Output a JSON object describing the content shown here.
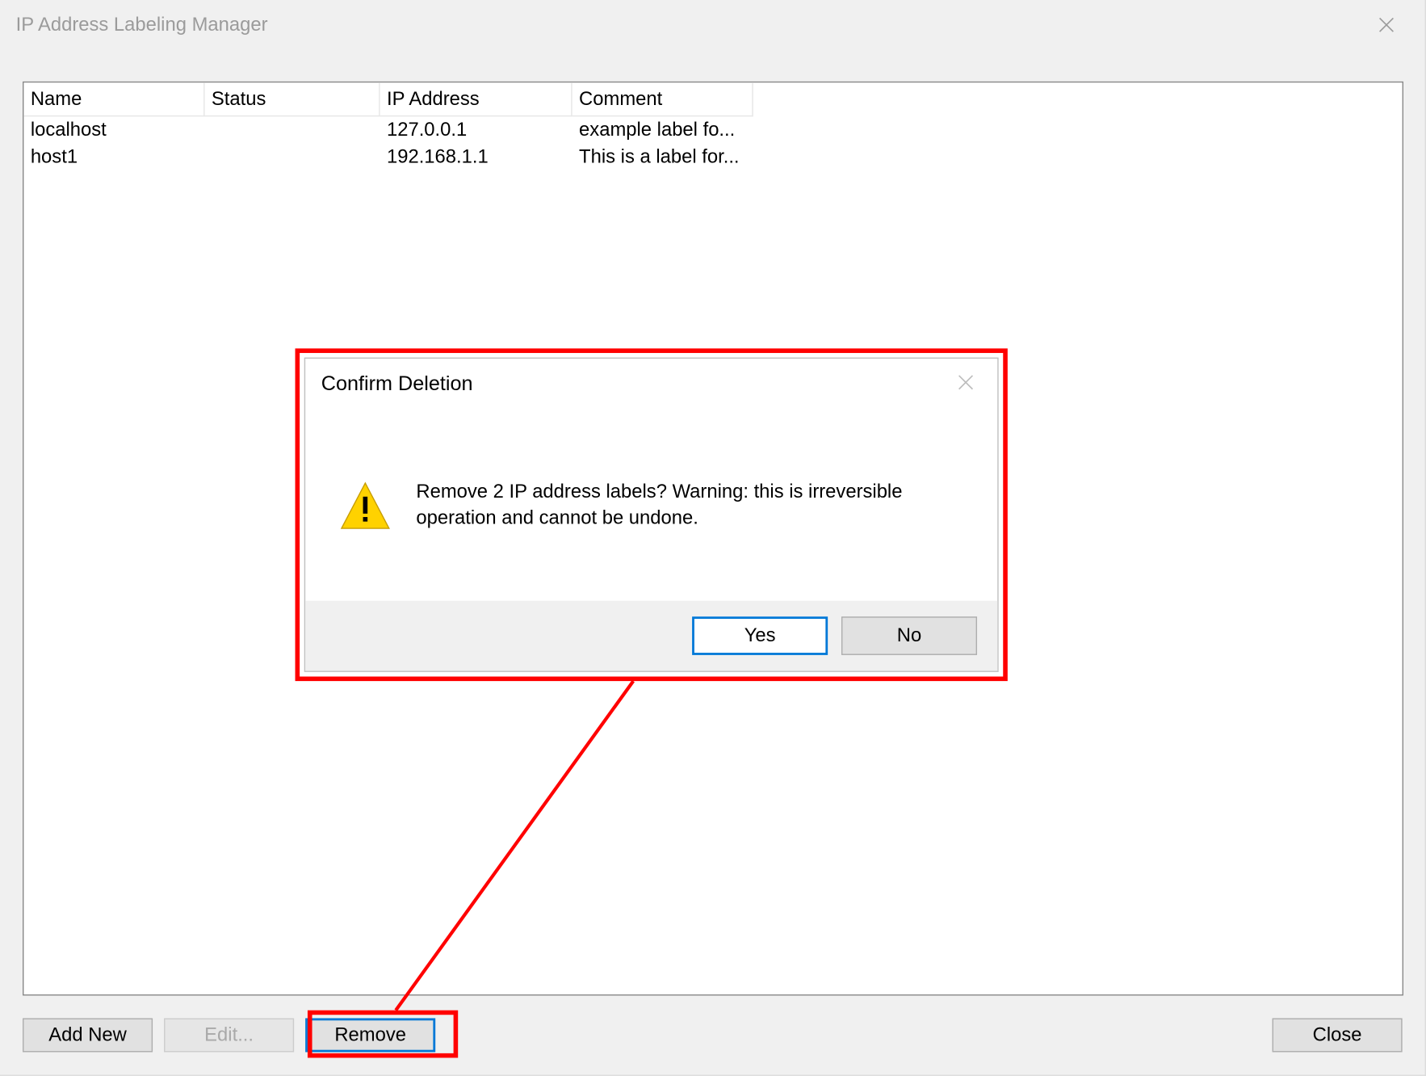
{
  "window": {
    "title": "IP Address Labeling Manager"
  },
  "table": {
    "headers": {
      "name": "Name",
      "status": "Status",
      "ip": "IP Address",
      "comment": "Comment"
    },
    "rows": [
      {
        "name": "localhost",
        "status": "",
        "ip": "127.0.0.1",
        "comment": "example label fo..."
      },
      {
        "name": "host1",
        "status": "",
        "ip": "192.168.1.1",
        "comment": "This is a label for..."
      }
    ]
  },
  "buttons": {
    "add": "Add New",
    "edit": "Edit...",
    "remove": "Remove",
    "close": "Close"
  },
  "dialog": {
    "title": "Confirm Deletion",
    "message": "Remove 2 IP address labels? Warning: this is irreversible operation and cannot be undone.",
    "yes": "Yes",
    "no": "No"
  }
}
